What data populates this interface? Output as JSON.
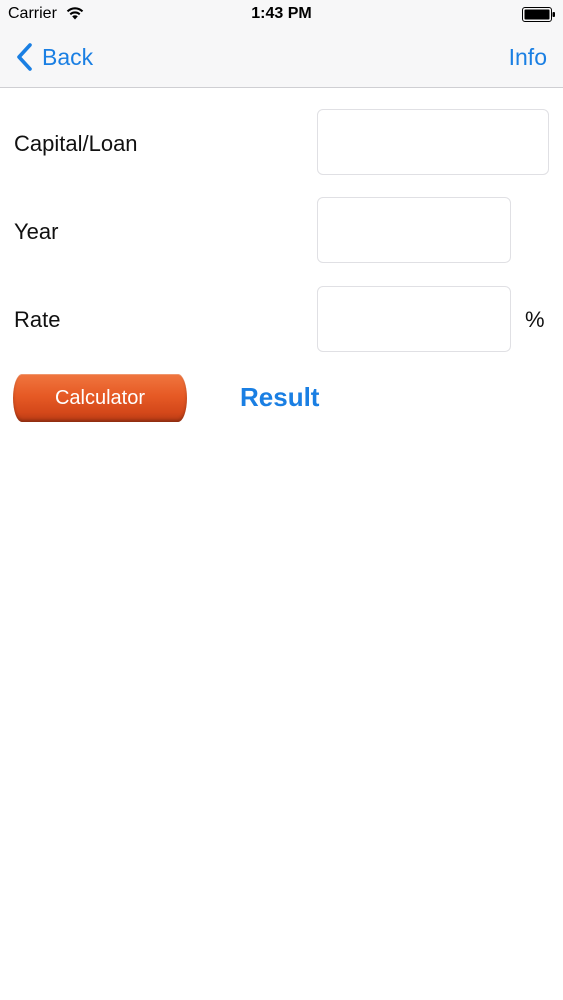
{
  "status_bar": {
    "carrier": "Carrier",
    "time": "1:43 PM",
    "wifi_icon": "wifi-icon",
    "battery_icon": "battery-icon"
  },
  "nav": {
    "back_label": "Back",
    "info_label": "Info",
    "tint_color": "#1a7fe3"
  },
  "form": {
    "capital_label": "Capital/Loan",
    "capital_value": "",
    "year_label": "Year",
    "year_value": "",
    "rate_label": "Rate",
    "rate_value": "",
    "percent_symbol": "%"
  },
  "actions": {
    "calculator_label": "Calculator",
    "calculator_color": "#e65a25",
    "result_label": "Result"
  }
}
